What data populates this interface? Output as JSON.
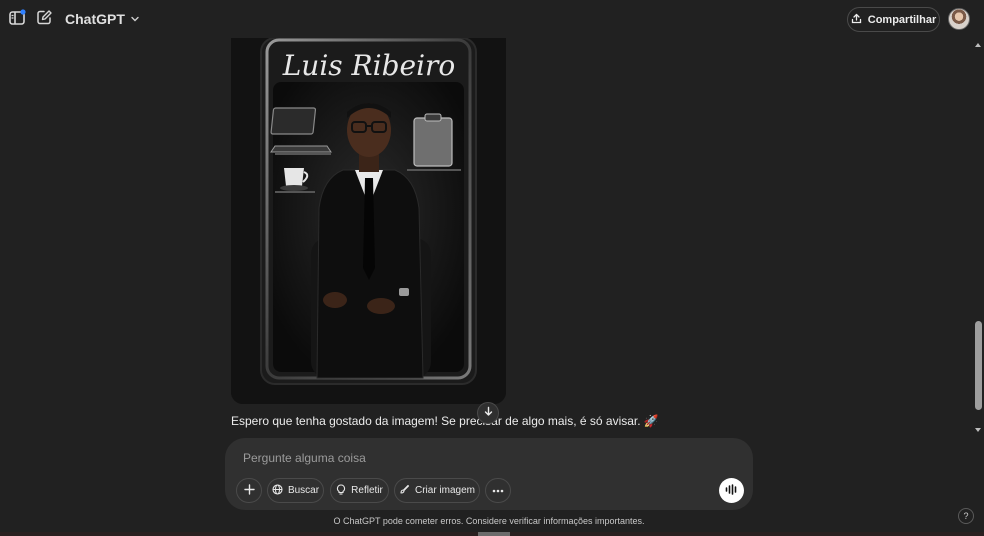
{
  "header": {
    "model_name": "ChatGPT",
    "share_label": "Compartilhar",
    "icons": {
      "sidebar": "sidebar-icon",
      "new_chat": "edit-icon",
      "model_dropdown": "chevron-down-icon",
      "share": "upload-icon"
    },
    "notification_dot_color": "#2f80ff"
  },
  "image": {
    "signature_text": "Luis Ribeiro"
  },
  "message": {
    "text": "Espero que tenha gostado da imagem! Se precisar de algo mais, é só avisar. 🚀"
  },
  "composer": {
    "placeholder": "Pergunte alguma coisa",
    "tools": {
      "buscar": "Buscar",
      "refletir": "Refletir",
      "criar_imagem": "Criar imagem"
    }
  },
  "footer": {
    "disclaimer": "O ChatGPT pode cometer erros. Considere verificar informações importantes.",
    "help": "?"
  }
}
